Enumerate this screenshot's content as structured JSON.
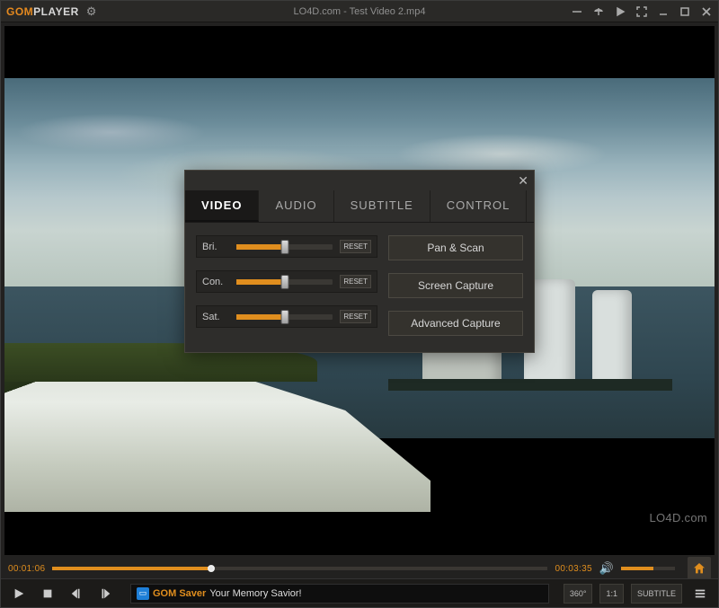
{
  "colors": {
    "accent": "#e08e1e"
  },
  "titlebar": {
    "logo_accent": "GOM",
    "logo_rest": "PLAYER",
    "title": "LO4D.com - Test Video 2.mp4"
  },
  "panel": {
    "tabs": {
      "video": "VIDEO",
      "audio": "AUDIO",
      "subtitle": "SUBTITLE",
      "control": "CONTROL"
    },
    "sliders": {
      "bri": {
        "label": "Bri.",
        "value_pct": 50,
        "reset_label": "RESET"
      },
      "con": {
        "label": "Con.",
        "value_pct": 50,
        "reset_label": "RESET"
      },
      "sat": {
        "label": "Sat.",
        "value_pct": 50,
        "reset_label": "RESET"
      }
    },
    "actions": {
      "panscan": "Pan & Scan",
      "screencap": "Screen Capture",
      "advcap": "Advanced Capture"
    }
  },
  "progress": {
    "current_time": "00:01:06",
    "total_time": "00:03:35",
    "position_pct": 32,
    "volume_pct": 60
  },
  "promo": {
    "brand": "GOM Saver",
    "tagline": "Your Memory Savior!"
  },
  "right_buttons": {
    "btn360": "360°",
    "ratio": "1:1",
    "subtitle": "SUBTITLE"
  },
  "watermark": "LO4D.com"
}
